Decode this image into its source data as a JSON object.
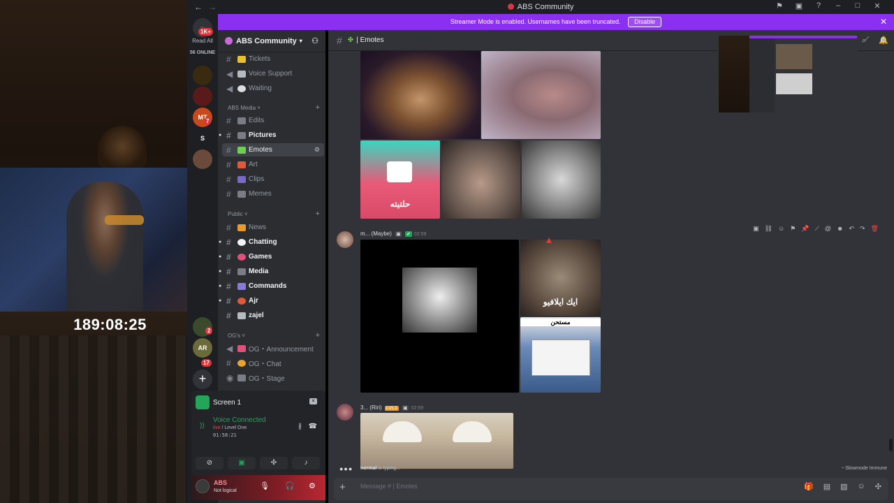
{
  "app": {
    "title": "ABS Community",
    "streamer_banner": "Streamer Mode is enabled. Usernames have been truncated.",
    "disable_label": "Disable"
  },
  "stream": {
    "timer": "189:08:25"
  },
  "guilds": {
    "read_all_badge": "1K+",
    "read_all": "Read All",
    "online": "56 ONLINE",
    "items": [
      {
        "label": "",
        "badge": ""
      },
      {
        "label": "",
        "badge": ""
      },
      {
        "label": "MT",
        "badge": "7"
      },
      {
        "label": "S",
        "badge": ""
      },
      {
        "label": "",
        "badge": ""
      },
      {
        "label": "",
        "badge": "2"
      },
      {
        "label": "AR",
        "badge": ""
      },
      {
        "label": "",
        "badge": "17"
      }
    ]
  },
  "server": {
    "name": "ABS Community"
  },
  "channels": {
    "top": [
      {
        "name": "Tickets",
        "icon": "ticket-icon"
      },
      {
        "name": "Voice Support",
        "icon": "speaker-icon"
      },
      {
        "name": "Waiting",
        "icon": "clock-icon"
      }
    ],
    "media_category": "ABS Media",
    "media": [
      {
        "name": "Edits"
      },
      {
        "name": "Pictures"
      },
      {
        "name": "Emotes"
      },
      {
        "name": "Art"
      },
      {
        "name": "Clips"
      },
      {
        "name": "Memes"
      }
    ],
    "public_category": "Public",
    "public": [
      {
        "name": "News"
      },
      {
        "name": "Chatting"
      },
      {
        "name": "Games"
      },
      {
        "name": "Media"
      },
      {
        "name": "Commands"
      },
      {
        "name": "Ajr"
      },
      {
        "name": "zajel"
      }
    ],
    "og_category": "OG's",
    "og": [
      {
        "name": "OG・Announcement"
      },
      {
        "name": "OG・Chat"
      },
      {
        "name": "OG・Stage"
      }
    ]
  },
  "voice": {
    "screen_label": "Screen 1",
    "connected": "Voice Connected",
    "sub_live": "live",
    "sub_level": "/ Level One",
    "time": "01:58:21"
  },
  "user": {
    "name": "ABS",
    "status": "Not logical"
  },
  "chat": {
    "channel": "Emotes",
    "messages": [
      {
        "author": "m... (Maybe)",
        "time": "02:59"
      },
      {
        "author": "3... (Riri)",
        "badge": "LVL1",
        "time": "02:59"
      }
    ],
    "media_captions": {
      "patrick": "حلتيته",
      "men": "ايك ايلافيو",
      "truck": "مستحن"
    },
    "typing_user": "normal",
    "typing_text": "is typing...",
    "slowmode": "Slowmode Immune",
    "placeholder": "Message #  | Emotes"
  }
}
